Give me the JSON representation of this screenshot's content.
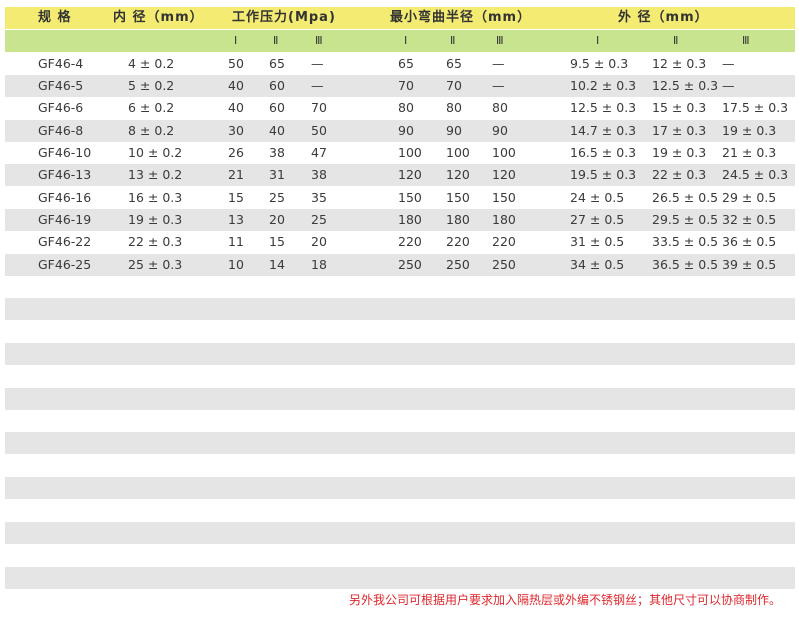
{
  "headers": {
    "spec": "规 格",
    "inner": "内  径（mm）",
    "pressure": "工作压力(Mpa)",
    "bend": "最小弯曲半径（mm）",
    "outer": "外  径（mm）",
    "levels": [
      "Ⅰ",
      "Ⅱ",
      "Ⅲ"
    ]
  },
  "rows": [
    [
      "GF46-4",
      "4 ± 0.2",
      "50",
      "65",
      "—",
      "65",
      "65",
      "—",
      "9.5 ± 0.3",
      "12 ± 0.3",
      "—"
    ],
    [
      "GF46-5",
      "5 ± 0.2",
      "40",
      "60",
      "—",
      "70",
      "70",
      "—",
      "10.2 ± 0.3",
      "12.5 ± 0.3",
      "—"
    ],
    [
      "GF46-6",
      "6 ± 0.2",
      "40",
      "60",
      "70",
      "80",
      "80",
      "80",
      "12.5 ± 0.3",
      "15 ± 0.3",
      "17.5 ± 0.3"
    ],
    [
      "GF46-8",
      "8 ± 0.2",
      "30",
      "40",
      "50",
      "90",
      "90",
      "90",
      "14.7 ± 0.3",
      "17 ± 0.3",
      "19 ± 0.3"
    ],
    [
      "GF46-10",
      "10 ± 0.2",
      "26",
      "38",
      "47",
      "100",
      "100",
      "100",
      "16.5 ± 0.3",
      "19 ± 0.3",
      "21 ± 0.3"
    ],
    [
      "GF46-13",
      "13 ± 0.2",
      "21",
      "31",
      "38",
      "120",
      "120",
      "120",
      "19.5 ± 0.3",
      "22 ± 0.3",
      "24.5 ± 0.3"
    ],
    [
      "GF46-16",
      "16 ± 0.3",
      "15",
      "25",
      "35",
      "150",
      "150",
      "150",
      "24 ± 0.5",
      "26.5 ± 0.5",
      "29 ± 0.5"
    ],
    [
      "GF46-19",
      "19 ± 0.3",
      "13",
      "20",
      "25",
      "180",
      "180",
      "180",
      "27 ± 0.5",
      "29.5 ± 0.5",
      "32 ± 0.5"
    ],
    [
      "GF46-22",
      "22 ± 0.3",
      "11",
      "15",
      "20",
      "220",
      "220",
      "220",
      "31 ± 0.5",
      "33.5 ± 0.5",
      "36 ± 0.5"
    ],
    [
      "GF46-25",
      "25 ± 0.3",
      "10",
      "14",
      "18",
      "250",
      "250",
      "250",
      "34 ± 0.5",
      "36.5 ± 0.5",
      "39 ± 0.5"
    ]
  ],
  "footnote": "另外我公司可根据用户要求加入隔热层或外编不锈钢丝；其他尺寸可以协商制作。"
}
